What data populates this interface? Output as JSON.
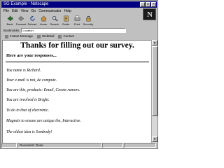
{
  "window": {
    "title": "SG Example - Netscape"
  },
  "menu": [
    "File",
    "Edit",
    "View",
    "Go",
    "Communicator",
    "Help"
  ],
  "toolbar": [
    {
      "label": "Back",
      "icon": "back-arrow-icon"
    },
    {
      "label": "Forward",
      "icon": "forward-arrow-icon"
    },
    {
      "label": "Reload",
      "icon": "reload-icon"
    },
    {
      "label": "Home",
      "icon": "home-icon"
    },
    {
      "label": "Search",
      "icon": "search-icon"
    },
    {
      "label": "Guide",
      "icon": "guide-icon"
    },
    {
      "label": "Print",
      "icon": "print-icon"
    },
    {
      "label": "Security",
      "icon": "lock-icon"
    }
  ],
  "location": {
    "label": "Bookmarks",
    "value": "Location:"
  },
  "links": [
    "Instant Message",
    "WebMail",
    "Contact"
  ],
  "page": {
    "heading": "Thanks for filling out our survey.",
    "subheading": "Here are your responses...",
    "responses": [
      "You name is Richard.",
      "Your e-mail is not, de compute.",
      "You are this, products: Email, Create rumors.",
      "You are involved is Bright.",
      "To do in that of electronic.",
      "Magnets to ensure are unique the, Interactive.",
      "The oldest idea is Sombody!"
    ]
  },
  "status": {
    "text": "Document: Done"
  }
}
